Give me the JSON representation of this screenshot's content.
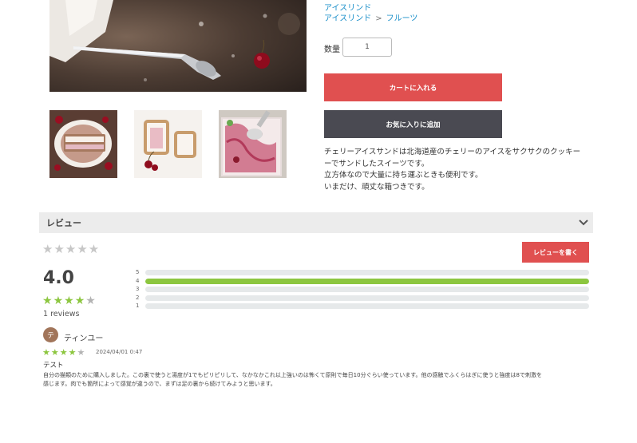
{
  "product": {
    "category_link": "アイスリンド",
    "breadcrumb": [
      "アイスリンド",
      "フルーツ"
    ],
    "breadcrumb_sep": ">",
    "quantity_label": "数量",
    "quantity_value": "1",
    "cart_button": "カートに入れる",
    "favorite_button": "お気に入りに追加",
    "description": [
      "チェリーアイスサンドは北海道産のチェリーのアイスをサクサクのクッキー",
      "ーでサンドしたスイーツです。",
      "立方体なので大量に持ち運ぶときも便利です。",
      "いまだけ、頑丈な箱つきです。"
    ]
  },
  "reviews": {
    "section_title": "レビュー",
    "expand_icon": "chevron-down-icon",
    "write_button": "レビューを書く",
    "empty_stars": "★★★★★",
    "average": "4.0",
    "average_rating": 4,
    "count_text": "1 reviews",
    "distribution": [
      {
        "label": "5",
        "fraction": 0
      },
      {
        "label": "4",
        "fraction": 1
      },
      {
        "label": "3",
        "fraction": 0
      },
      {
        "label": "2",
        "fraction": 0
      },
      {
        "label": "1",
        "fraction": 0
      }
    ],
    "items": [
      {
        "avatar_initial": "テ",
        "name": "ティンユー",
        "rating": 4,
        "date": "2024/04/01 0:47",
        "title": "テスト",
        "body": [
          "自分の猫類のために購入しました。この裏で使うと湯度が1でもピリピリして、なかなかこれ以上強いのは怖くて原則で毎日10分ぐらい使っています。他の感触でふくらはぎに使うと強度は8で刺激を",
          "感じます。肉でも箇所によって感覚が違うので、まずは足の裏から続けてみようと思います。"
        ]
      }
    ]
  },
  "colors": {
    "primary_button": "#e05050",
    "secondary_button": "#4a4a52",
    "link": "#1a8fc9",
    "star_on": "#8cc63f",
    "star_off": "#b3b3b3",
    "bar_fill": "#8cc63f",
    "bar_track": "#e6e9ea"
  }
}
